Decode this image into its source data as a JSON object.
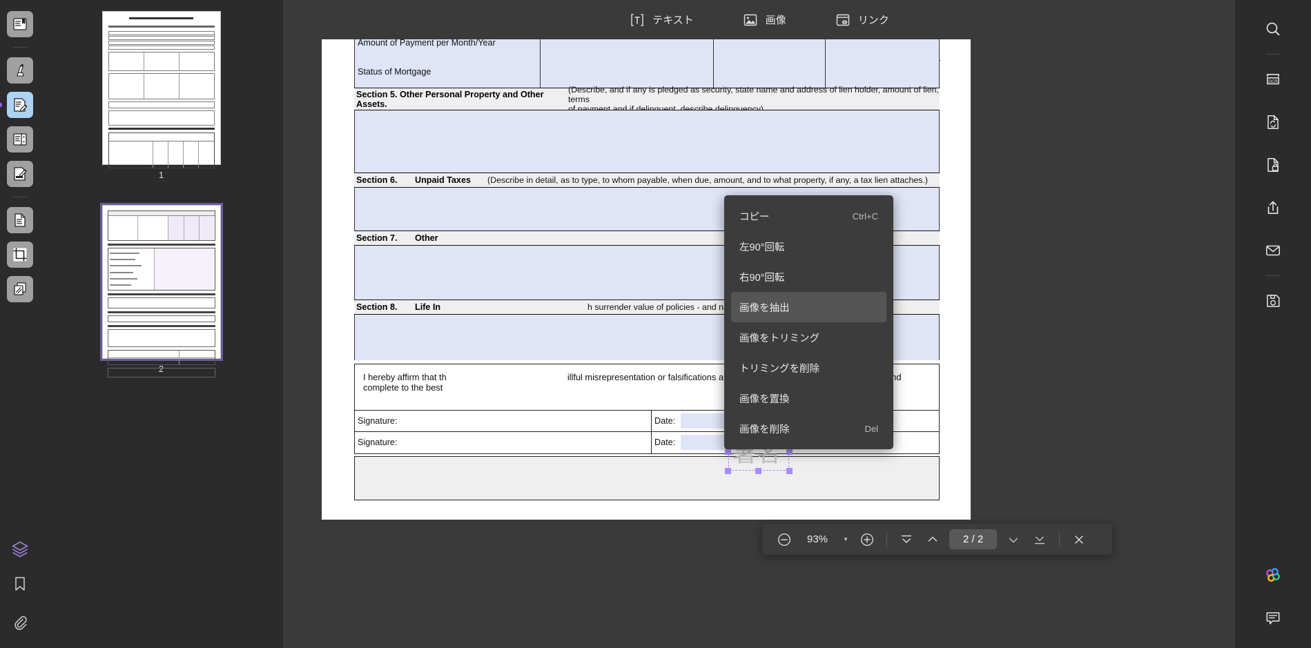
{
  "app": {
    "theme_bg": "#2b2b2b",
    "accent": "#9b5de5",
    "selection_color": "#a78bfa"
  },
  "toolbar": {
    "items": [
      {
        "label": "テキスト",
        "icon": "text-box-icon"
      },
      {
        "label": "画像",
        "icon": "image-icon"
      },
      {
        "label": "リンク",
        "icon": "link-icon"
      }
    ]
  },
  "left_rail": {
    "items": [
      {
        "name": "read-mode",
        "icon": "book-read-icon"
      },
      {
        "name": "highlight-tool",
        "icon": "marker-pen-icon"
      },
      {
        "name": "edit-tool",
        "icon": "document-pencil-icon"
      },
      {
        "name": "organize-pages",
        "icon": "page-list-icon"
      },
      {
        "name": "sign-tool",
        "icon": "signature-icon"
      },
      {
        "name": "extract-page",
        "icon": "document-extract-icon"
      },
      {
        "name": "crop-tool",
        "icon": "crop-icon"
      },
      {
        "name": "compare-tool",
        "icon": "layers-copy-icon"
      },
      {
        "name": "layers-panel",
        "icon": "layers-icon"
      },
      {
        "name": "bookmarks-panel",
        "icon": "bookmark-icon"
      },
      {
        "name": "attachments-panel",
        "icon": "paperclip-icon"
      }
    ],
    "selected_index": 2
  },
  "right_rail": {
    "items": [
      {
        "name": "search",
        "icon": "search-icon"
      },
      {
        "name": "ocr",
        "icon": "ocr-icon"
      },
      {
        "name": "convert",
        "icon": "document-sync-icon"
      },
      {
        "name": "protect",
        "icon": "document-lock-icon"
      },
      {
        "name": "share",
        "icon": "share-upload-icon"
      },
      {
        "name": "email",
        "icon": "mail-icon"
      },
      {
        "name": "save-as",
        "icon": "floppy-save-icon"
      },
      {
        "name": "ai-assistant",
        "icon": "ai-clover-icon"
      },
      {
        "name": "comments",
        "icon": "comment-icon"
      }
    ]
  },
  "thumbnails": {
    "pages": [
      {
        "label": "1",
        "current": false
      },
      {
        "label": "2",
        "current": true
      }
    ]
  },
  "context_menu": {
    "items": [
      {
        "label": "コピー",
        "shortcut": "Ctrl+C",
        "highlighted": false
      },
      {
        "label": "左90°回転",
        "shortcut": "",
        "highlighted": false
      },
      {
        "label": "右90°回転",
        "shortcut": "",
        "highlighted": false
      },
      {
        "label": "画像を抽出",
        "shortcut": "",
        "highlighted": true
      },
      {
        "label": "画像をトリミング",
        "shortcut": "",
        "highlighted": false
      },
      {
        "label": "トリミングを削除",
        "shortcut": "",
        "highlighted": false
      },
      {
        "label": "画像を置換",
        "shortcut": "",
        "highlighted": false
      },
      {
        "label": "画像を削除",
        "shortcut": "Del",
        "highlighted": false
      }
    ]
  },
  "document": {
    "rows": {
      "amount_payment": "Amount of Payment per Month/Year",
      "status_mortgage": "Status of Mortgage",
      "section5_title": "Section 5. Other Personal Property and Other Assets.",
      "section5_note_line1": "(Describe, and if any is pledged as security, state name and address of lien holder, amount of lien, terms",
      "section5_note_line2": "of payment and if delinquent, describe delinquency)",
      "section6_num": "Section 6.",
      "section6_title": "Unpaid Taxes",
      "section6_note": "(Describe in detail, as to type, to whom payable, when due, amount, and to what property, if any, a tax lien attaches.)",
      "section7_num": "Section 7.",
      "section7_title": "Other",
      "section8_num": "Section 8.",
      "section8_title": "Life In",
      "section8_note": "h surrender value of policies - and name of insurance company.",
      "affirm_line1_a": "I hereby affirm that th",
      "affirm_line1_b": "illful misrepresentation or falsifications and this information given by me/us is true and",
      "affirm_line2": "complete to the best",
      "signature_label_1": "Signature:",
      "signature_label_2": "Signature:",
      "date_label_1": "Date:",
      "date_label_2": "Date:"
    },
    "signature_image_text": "署名"
  },
  "zoom_bar": {
    "zoom_out": "zoom-out-icon",
    "zoom_level": "93%",
    "dropdown": "▾",
    "zoom_in": "zoom-in-icon",
    "first_page": "first-page-icon",
    "prev_page": "prev-page-icon",
    "page_indicator": "2 / 2",
    "next_page": "next-page-icon",
    "last_page": "last-page-icon",
    "close": "close-icon"
  }
}
